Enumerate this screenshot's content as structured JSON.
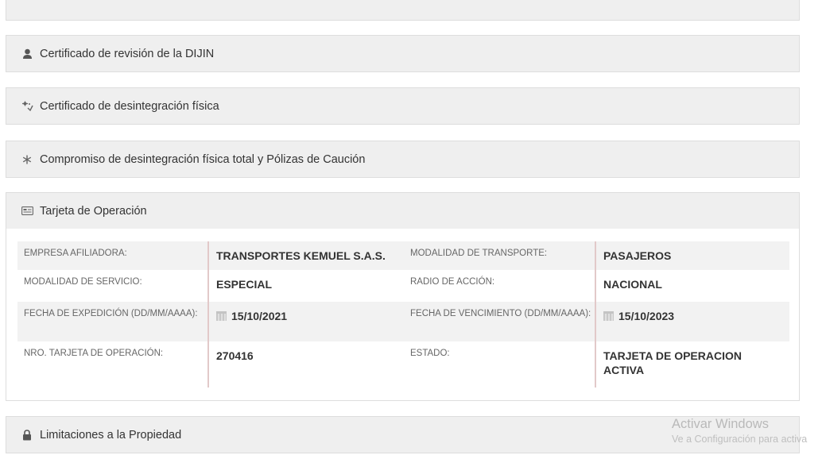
{
  "sections": {
    "dijin": {
      "title": "Certificado de revisión de la DIJIN",
      "icon": "user-icon"
    },
    "desintegracion": {
      "title": "Certificado de desintegración física",
      "icon": "recycle-icon"
    },
    "compromiso": {
      "title": "Compromiso de desintegración física total y Pólizas de Caución",
      "icon": "asterisk-icon"
    },
    "tarjeta": {
      "title": "Tarjeta de Operación",
      "icon": "card-icon"
    },
    "limitaciones": {
      "title": "Limitaciones a la Propiedad",
      "icon": "lock-icon"
    }
  },
  "tarjeta_details": {
    "empresa_label": "EMPRESA AFILIADORA:",
    "empresa_value": "TRANSPORTES KEMUEL S.A.S.",
    "modalidad_transporte_label": "MODALIDAD DE TRANSPORTE:",
    "modalidad_transporte_value": "PASAJEROS",
    "modalidad_servicio_label": "MODALIDAD DE SERVICIO:",
    "modalidad_servicio_value": "ESPECIAL",
    "radio_label": "RADIO DE ACCIÓN:",
    "radio_value": "NACIONAL",
    "fecha_exp_label": "FECHA DE EXPEDICIÓN (DD/MM/AAAA):",
    "fecha_exp_value": "15/10/2021",
    "fecha_venc_label": "FECHA DE VENCIMIENTO (DD/MM/AAAA):",
    "fecha_venc_value": "15/10/2023",
    "nro_label": "NRO. TARJETA DE OPERACIÓN:",
    "nro_value": "270416",
    "estado_label": "ESTADO:",
    "estado_value": "TARJETA DE OPERACION ACTIVA"
  },
  "watermark": {
    "title": "Activar Windows",
    "subtitle": "Ve a Configuración para activa"
  }
}
